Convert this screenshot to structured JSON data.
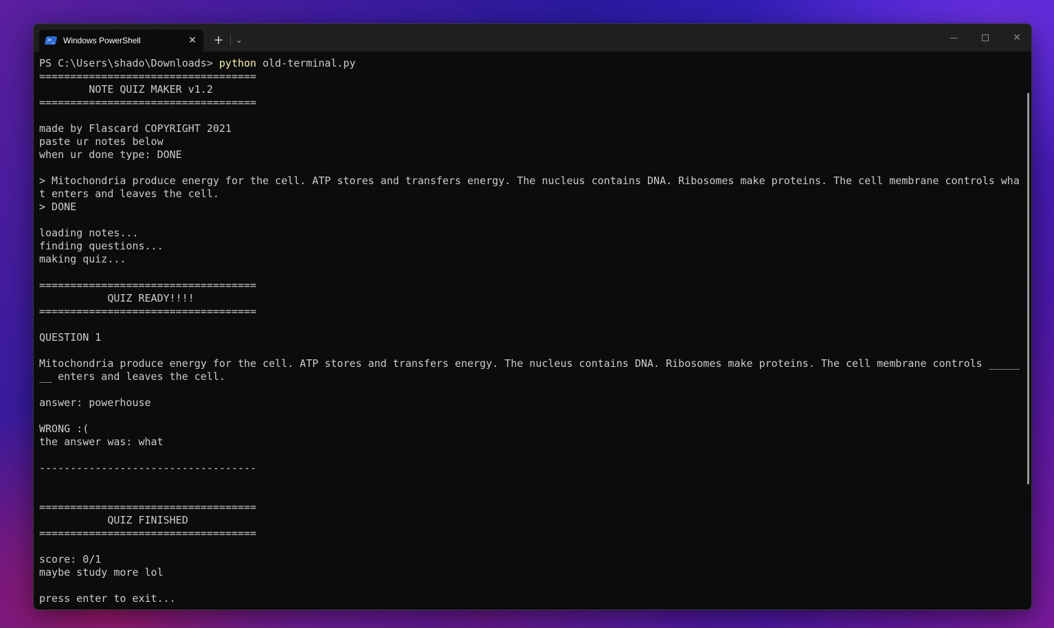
{
  "window": {
    "tab_title": "Windows PowerShell",
    "tab_icon": "powershell-icon",
    "close_tab_glyph": "✕",
    "new_tab_glyph": "+",
    "dropdown_glyph": "⌄",
    "minimize_icon": "minimize-icon",
    "maximize_icon": "maximize-icon",
    "close_glyph": "✕"
  },
  "terminal": {
    "prompt": "PS C:\\Users\\shado\\Downloads> ",
    "command": "python",
    "argument": " old-terminal.py",
    "lines": [
      "===================================",
      "        NOTE QUIZ MAKER v1.2",
      "===================================",
      "",
      "made by Flascard COPYRIGHT 2021",
      "paste ur notes below",
      "when ur done type: DONE",
      "",
      "> Mitochondria produce energy for the cell. ATP stores and transfers energy. The nucleus contains DNA. Ribosomes make proteins. The cell membrane controls wha",
      "t enters and leaves the cell.",
      "> DONE",
      "",
      "loading notes...",
      "finding questions...",
      "making quiz...",
      "",
      "===================================",
      "           QUIZ READY!!!!",
      "===================================",
      "",
      "QUESTION 1",
      "",
      "Mitochondria produce energy for the cell. ATP stores and transfers energy. The nucleus contains DNA. Ribosomes make proteins. The cell membrane controls _____",
      "__ enters and leaves the cell.",
      "",
      "answer: powerhouse",
      "",
      "WRONG :(",
      "the answer was: what",
      "",
      "-----------------------------------",
      "",
      "",
      "===================================",
      "           QUIZ FINISHED",
      "===================================",
      "",
      "score: 0/1",
      "maybe study more lol",
      "",
      "press enter to exit..."
    ]
  },
  "colors": {
    "terminal_bg": "#0c0c0c",
    "text": "#cccccc",
    "command_highlight": "#f9f1a5",
    "titlebar_bg": "#1f1f1f"
  }
}
